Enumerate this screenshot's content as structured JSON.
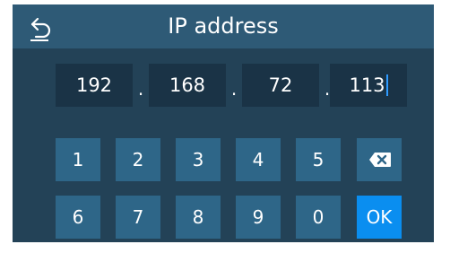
{
  "header": {
    "title": "IP address",
    "back_icon": "back-arrow-icon"
  },
  "ip": {
    "octets": [
      "192",
      "168",
      "72",
      "113"
    ],
    "separator": "."
  },
  "keypad": {
    "row1": [
      "1",
      "2",
      "3",
      "4",
      "5"
    ],
    "row2": [
      "6",
      "7",
      "8",
      "9",
      "0"
    ],
    "backspace_icon": "backspace-icon",
    "ok_label": "OK"
  },
  "colors": {
    "background": "#234257",
    "header": "#2e5a76",
    "field": "#1a3346",
    "key": "#2e6688",
    "ok": "#0a8ef0",
    "caret": "#2f9bff"
  }
}
